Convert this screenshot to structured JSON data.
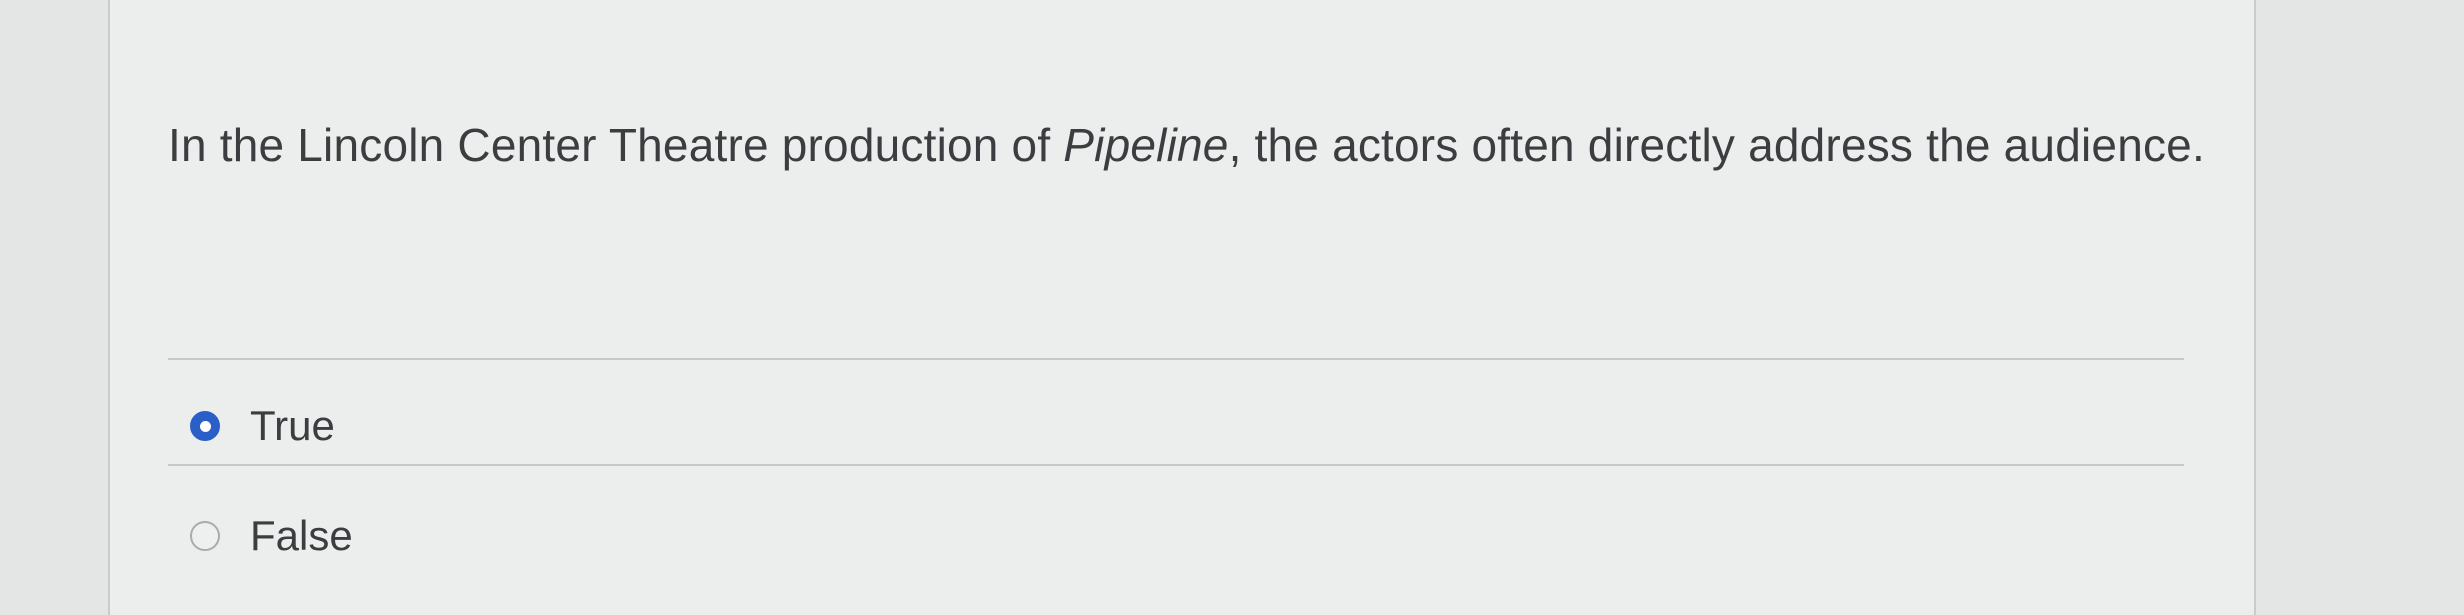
{
  "question": {
    "text_before": "In the Lincoln Center Theatre production of ",
    "title_italic": "Pipeline",
    "text_after": ", the actors often directly address the audience."
  },
  "options": [
    {
      "label": "True",
      "selected": true
    },
    {
      "label": "False",
      "selected": false
    }
  ],
  "colors": {
    "accent": "#2a5fc8",
    "text": "#3b3d40",
    "background": "#eceeed"
  }
}
